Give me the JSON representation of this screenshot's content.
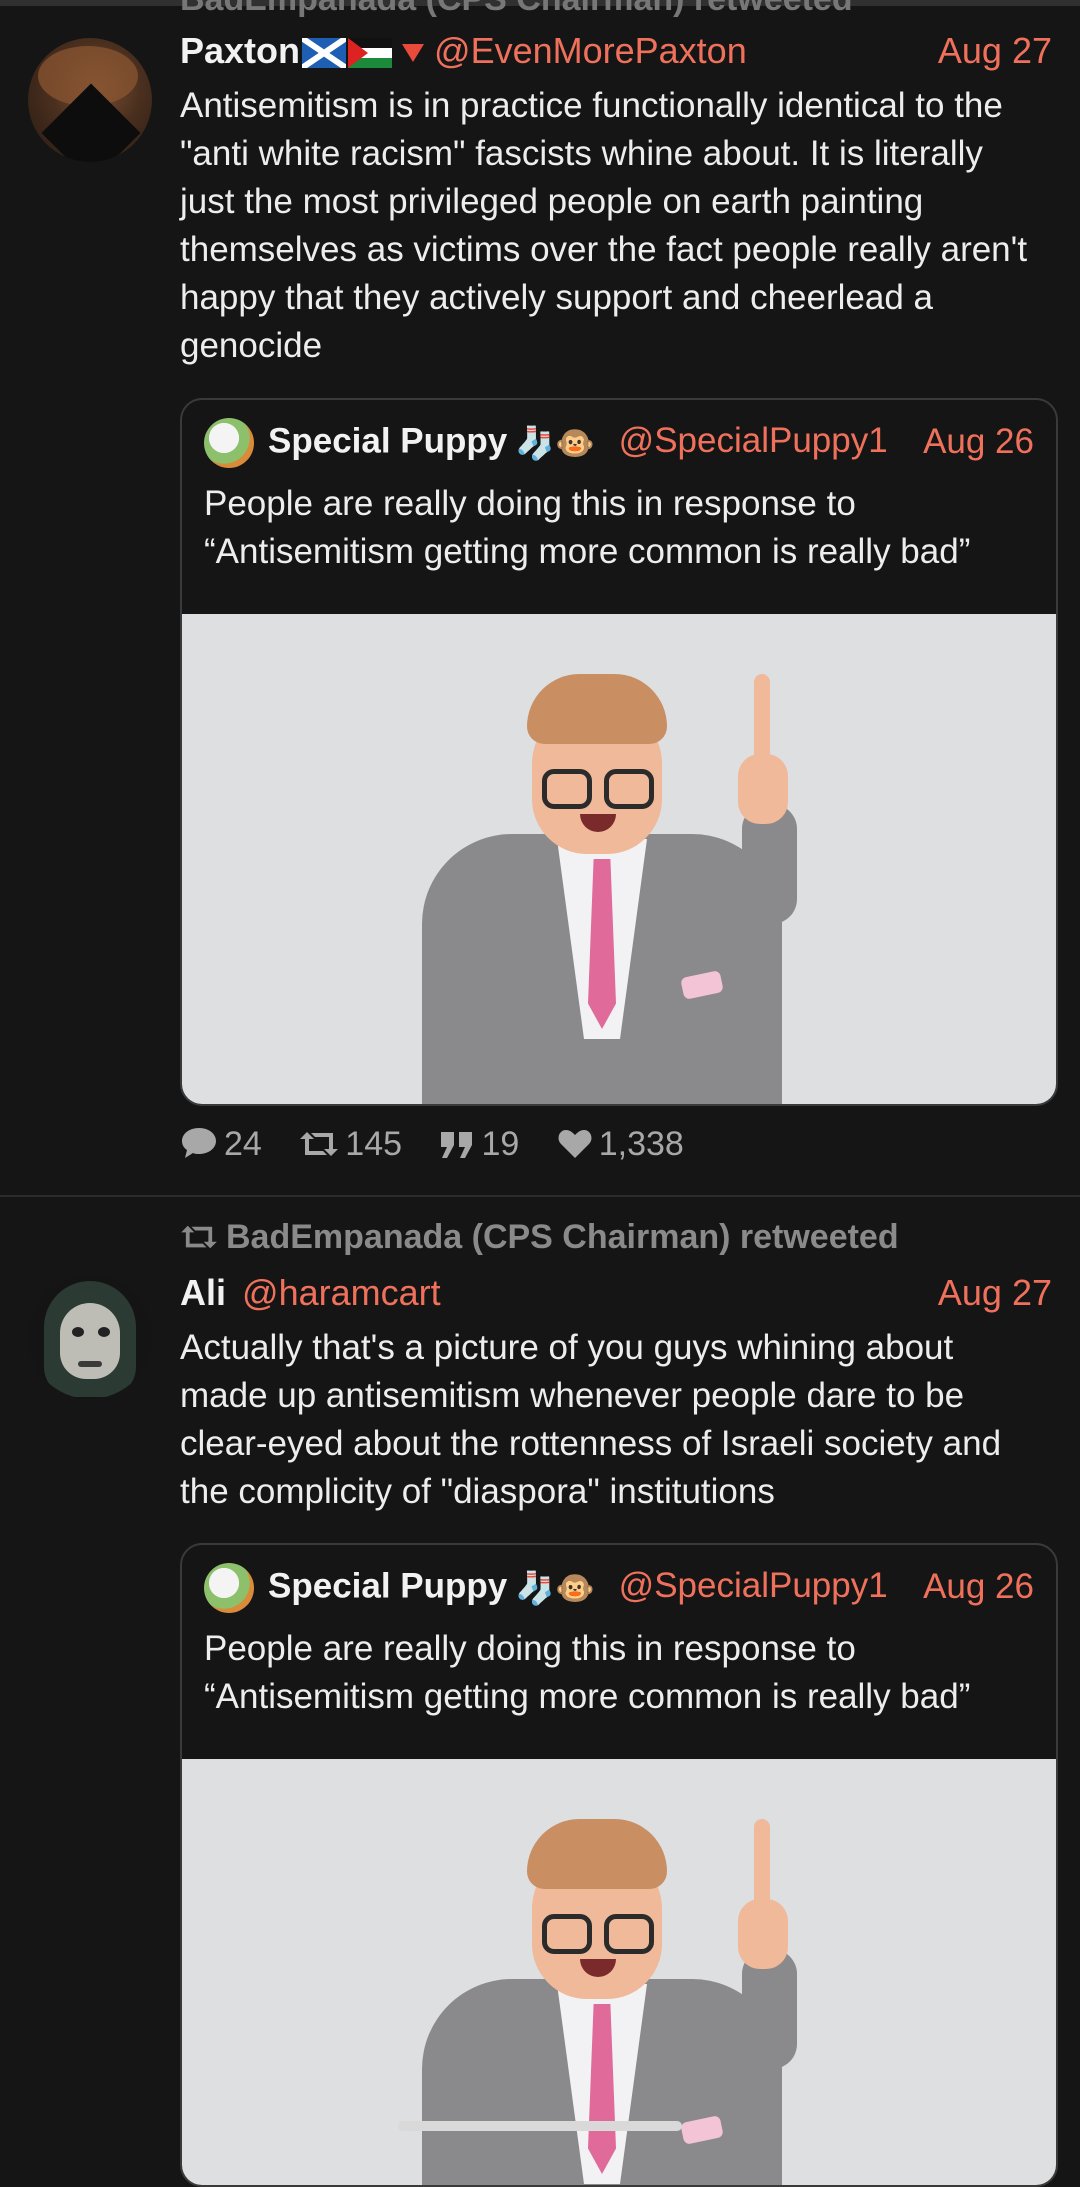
{
  "retweet_cut": "BadEmpanada (CPS Chairman) retweeted",
  "posts": [
    {
      "name": "Paxton",
      "handle": "@EvenMorePaxton",
      "date": "Aug 27",
      "text": "Antisemitism is in practice functionally identical to the \"anti white racism\" fascists whine about. It is literally just the most privileged people on earth painting themselves as victims over the fact people really aren't happy that they actively support and cheerlead a genocide",
      "quote": {
        "name": "Special Puppy",
        "emoji": "🧦🐵",
        "handle": "@SpecialPuppy1",
        "date": "Aug 26",
        "text": "People are really doing this in response to “Antisemitism getting more common is really bad”"
      },
      "stats": {
        "replies": "24",
        "retweets": "145",
        "quotes": "19",
        "likes": "1,338"
      }
    },
    {
      "retweeted_by": "BadEmpanada (CPS Chairman) retweeted",
      "name": "Ali",
      "handle": "@haramcart",
      "date": "Aug 27",
      "text": "Actually that's a picture of you guys whining about made up antisemitism whenever people dare to be clear-eyed about the rottenness of Israeli society and the complicity of \"diaspora\" institutions",
      "quote": {
        "name": "Special Puppy",
        "emoji": "🧦🐵",
        "handle": "@SpecialPuppy1",
        "date": "Aug 26",
        "text": "People are really doing this in response to “Antisemitism getting more common is really bad”"
      }
    }
  ],
  "colors": {
    "accent": "#f0715b",
    "background": "#151515",
    "muted": "#a8a8a8"
  }
}
